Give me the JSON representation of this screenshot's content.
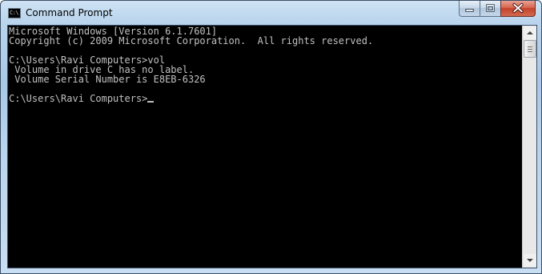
{
  "window": {
    "title": "Command Prompt",
    "icon": "cmd-icon",
    "icon_glyph": "C:\\",
    "caption_buttons": [
      "minimize-icon",
      "maximize-icon",
      "close-icon"
    ]
  },
  "console": {
    "lines": [
      "Microsoft Windows [Version 6.1.7601]",
      "Copyright (c) 2009 Microsoft Corporation.  All rights reserved.",
      "",
      "C:\\Users\\Ravi Computers>vol",
      " Volume in drive C has no label.",
      " Volume Serial Number is E8EB-6326",
      "",
      "C:\\Users\\Ravi Computers>"
    ],
    "colors": {
      "background": "#000000",
      "foreground": "#c0c0c0"
    }
  },
  "colors": {
    "frame": "#b9d4ec",
    "close_button": "#c5412b"
  }
}
